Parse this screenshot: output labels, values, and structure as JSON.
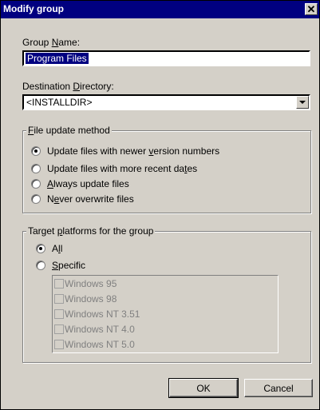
{
  "window": {
    "title": "Modify group",
    "close_glyph": "✕"
  },
  "group_name": {
    "label_pre": "Group ",
    "label_u": "N",
    "label_post": "ame:",
    "value": "Program Files"
  },
  "destination": {
    "label_pre": "Destination ",
    "label_u": "D",
    "label_post": "irectory:",
    "value": "<INSTALLDIR>"
  },
  "update_method": {
    "legend_u": "F",
    "legend_post": "ile update method",
    "options": [
      {
        "pre": "Update files with newer ",
        "u": "v",
        "post": "ersion numbers",
        "selected": true
      },
      {
        "pre": "Update files with more recent da",
        "u": "t",
        "post": "es",
        "selected": false
      },
      {
        "pre": "",
        "u": "A",
        "post": "lways update files",
        "selected": false
      },
      {
        "pre": "N",
        "u": "e",
        "post": "ver overwrite files",
        "selected": false
      }
    ]
  },
  "platforms": {
    "legend_pre": "Target ",
    "legend_u": "p",
    "legend_post": "latforms for the group",
    "all": {
      "pre": "A",
      "u": "l",
      "post": "l",
      "selected": true
    },
    "specific": {
      "pre": "",
      "u": "S",
      "post": "pecific",
      "selected": false
    },
    "list": [
      "Windows 95",
      "Windows 98",
      "Windows NT 3.51",
      "Windows NT 4.0",
      "Windows NT 5.0"
    ]
  },
  "buttons": {
    "ok": "OK",
    "cancel": "Cancel"
  }
}
